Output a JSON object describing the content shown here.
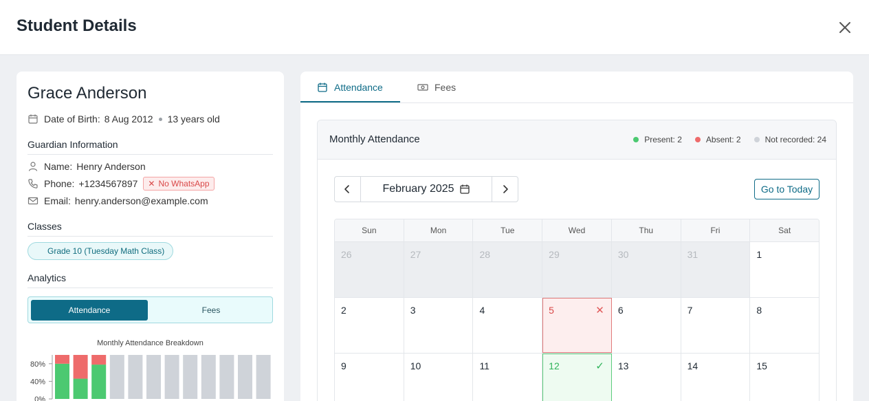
{
  "modal": {
    "title": "Student Details"
  },
  "student": {
    "name": "Grace Anderson",
    "dob_label": "Date of Birth:",
    "dob": "8 Aug 2012",
    "age": "13 years old"
  },
  "guardian": {
    "section_title": "Guardian Information",
    "name_label": "Name:",
    "name": "Henry Anderson",
    "phone_label": "Phone:",
    "phone": "+1234567897",
    "whatsapp_badge": "No WhatsApp",
    "email_label": "Email:",
    "email": "henry.anderson@example.com"
  },
  "classes": {
    "section_title": "Classes",
    "items": [
      "Grade 10 (Tuesday Math Class)"
    ]
  },
  "analytics": {
    "section_title": "Analytics",
    "toggle": {
      "active": "Attendance",
      "inactive": "Fees"
    },
    "chart_title": "Monthly Attendance Breakdown"
  },
  "chart_data": {
    "type": "bar",
    "title": "Monthly Attendance Breakdown",
    "y_ticks": [
      "80%",
      "40%",
      "0%"
    ],
    "ylim": [
      0,
      100
    ],
    "series": [
      {
        "name": "Present",
        "color": "#4cc971",
        "values": [
          80,
          46,
          78,
          0,
          0,
          0,
          0,
          0,
          0,
          0,
          0,
          0
        ]
      },
      {
        "name": "Absent",
        "color": "#ee6b6b",
        "values": [
          20,
          54,
          22,
          0,
          0,
          0,
          0,
          0,
          0,
          0,
          0,
          0
        ]
      },
      {
        "name": "Not recorded",
        "color": "#cfd3d9",
        "values": [
          0,
          0,
          0,
          100,
          100,
          100,
          100,
          100,
          100,
          100,
          100,
          100
        ]
      }
    ]
  },
  "tabs": [
    {
      "label": "Attendance",
      "icon": "calendar-icon"
    },
    {
      "label": "Fees",
      "icon": "banknote-icon"
    }
  ],
  "attendance": {
    "panel_title": "Monthly Attendance",
    "legend": {
      "present": "Present: 2",
      "absent": "Absent: 2",
      "not_recorded": "Not recorded: 24"
    },
    "colors": {
      "present": "#4cc971",
      "absent": "#ee6b6b",
      "not_recorded": "#cfd3d9"
    },
    "month_label": "February 2025",
    "today_button": "Go to Today",
    "weekdays": [
      "Sun",
      "Mon",
      "Tue",
      "Wed",
      "Thu",
      "Fri",
      "Sat"
    ],
    "weeks": [
      [
        {
          "d": "26",
          "state": "other"
        },
        {
          "d": "27",
          "state": "other"
        },
        {
          "d": "28",
          "state": "other"
        },
        {
          "d": "29",
          "state": "other"
        },
        {
          "d": "30",
          "state": "other"
        },
        {
          "d": "31",
          "state": "other"
        },
        {
          "d": "1",
          "state": "normal"
        }
      ],
      [
        {
          "d": "2",
          "state": "normal"
        },
        {
          "d": "3",
          "state": "normal"
        },
        {
          "d": "4",
          "state": "normal"
        },
        {
          "d": "5",
          "state": "absent"
        },
        {
          "d": "6",
          "state": "normal"
        },
        {
          "d": "7",
          "state": "normal"
        },
        {
          "d": "8",
          "state": "normal"
        }
      ],
      [
        {
          "d": "9",
          "state": "normal"
        },
        {
          "d": "10",
          "state": "normal"
        },
        {
          "d": "11",
          "state": "normal"
        },
        {
          "d": "12",
          "state": "present"
        },
        {
          "d": "13",
          "state": "normal"
        },
        {
          "d": "14",
          "state": "normal"
        },
        {
          "d": "15",
          "state": "normal"
        }
      ]
    ]
  }
}
